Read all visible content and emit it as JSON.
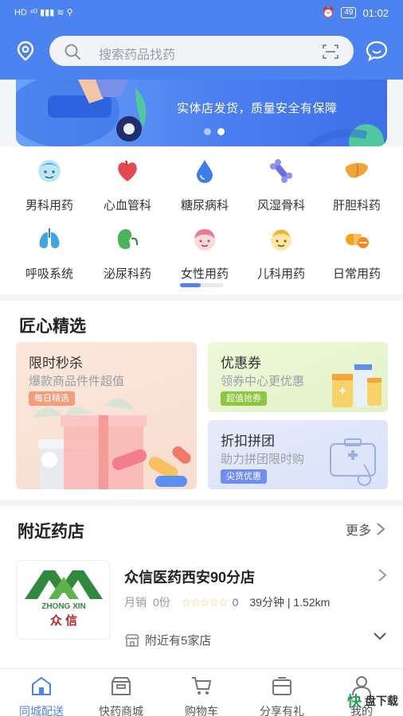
{
  "status": {
    "left_icons": "HD ⁴ᴳ ▮▮▮ ≋ ⚲",
    "alarm_icon": "⏰",
    "battery": "49",
    "time": "01:02"
  },
  "header": {
    "search_placeholder": "搜索药品找药"
  },
  "banner": {
    "text": "实体店发货，质量安全有保障"
  },
  "categories": [
    {
      "label": "男科用药",
      "icon": "male-face-icon",
      "color": "#4bb7e6"
    },
    {
      "label": "心血管科",
      "icon": "heart-icon",
      "color": "#e5484d"
    },
    {
      "label": "糖尿病科",
      "icon": "drop-icon",
      "color": "#3d7de8"
    },
    {
      "label": "风湿骨科",
      "icon": "bone-icon",
      "color": "#6a6fe0"
    },
    {
      "label": "肝胆科药",
      "icon": "liver-icon",
      "color": "#f2a33a"
    },
    {
      "label": "呼吸系统",
      "icon": "lungs-icon",
      "color": "#3fa7e0"
    },
    {
      "label": "泌尿科药",
      "icon": "kidney-icon",
      "color": "#49b35a"
    },
    {
      "label": "女性用药",
      "icon": "female-face-icon",
      "color": "#ef7a8e"
    },
    {
      "label": "儿科用药",
      "icon": "child-face-icon",
      "color": "#f3b233"
    },
    {
      "label": "日常用药",
      "icon": "pill-icon",
      "color": "#f2a31f"
    }
  ],
  "selection": {
    "title": "匠心精选",
    "cards": [
      {
        "title": "限时秒杀",
        "subtitle": "爆款商品件件超值",
        "tag": "每日精选"
      },
      {
        "title": "优惠券",
        "subtitle": "领券中心更优惠",
        "tag": "超值抢券"
      },
      {
        "title": "折扣拼团",
        "subtitle": "助力拼团限时购",
        "tag": "尖货优惠"
      }
    ]
  },
  "nearby": {
    "title": "附近药店",
    "more": "更多",
    "store": {
      "logo_text_en": "ZHONG XIN",
      "logo_text_cn": "众 信",
      "name": "众信医药西安90分店",
      "sales_label": "月销",
      "sales_value": "0份",
      "rating": "0",
      "stars": "☆☆☆☆☆",
      "time_distance": "39分钟 | 1.52km",
      "branch": "附近有5家店"
    }
  },
  "tabs": [
    {
      "label": "同城配送",
      "icon": "house-icon",
      "active": true
    },
    {
      "label": "快药商城",
      "icon": "store-icon",
      "active": false
    },
    {
      "label": "购物车",
      "icon": "cart-icon",
      "active": false
    },
    {
      "label": "分享有礼",
      "icon": "share-box-icon",
      "active": false
    },
    {
      "label": "我的",
      "icon": "user-icon",
      "active": false
    }
  ],
  "watermark": {
    "brand": "快",
    "text": "盘下载"
  },
  "colors": {
    "primary": "#4c83f1",
    "star": "#f7c96a"
  }
}
